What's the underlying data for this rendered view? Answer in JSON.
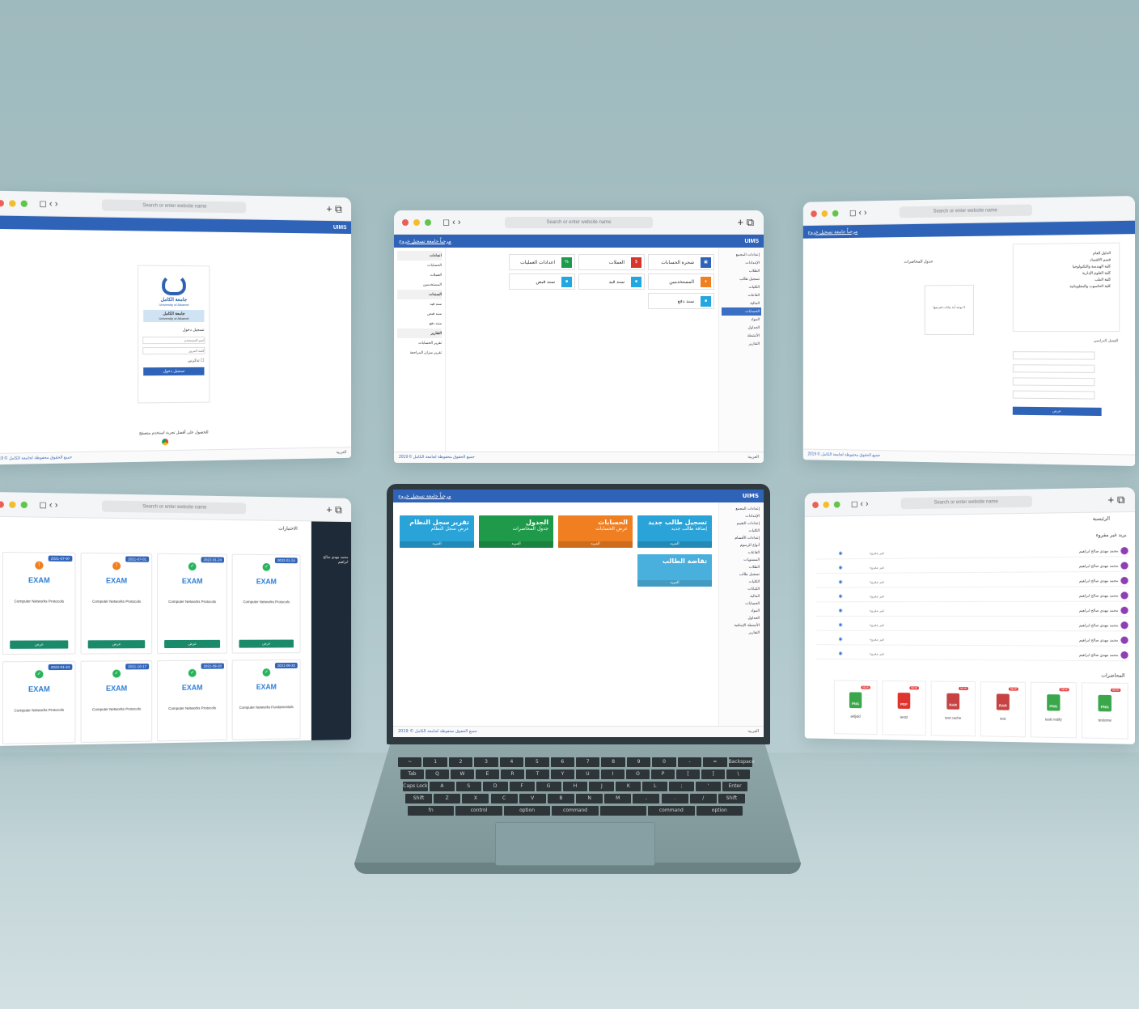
{
  "colors": {
    "accent": "#2f63b8",
    "background": "#a8c1c5",
    "laptop": "#7e9598"
  },
  "browser": {
    "search_placeholder": "Search or enter website name",
    "controls": "◻ ‹ ›",
    "new_tab": "+ ⧉"
  },
  "app": {
    "name": "UIMS",
    "breadcrumb": "مرحباً جامعة تسجيل خروج",
    "footer_link": "جميع الحقوق محفوظة لجامعة الكامل © 2019",
    "lang": "العربية"
  },
  "login": {
    "logo_text": "جامعة الكامل",
    "logo_sub": "University of Alkamel",
    "banner_title": "جامعة الكامل",
    "banner_sub": "University of Alkamel",
    "section": "تسجيل دخول",
    "user_placeholder": "اسم المستخدم",
    "pass_placeholder": "كلمة المرور",
    "remember": "تذكرني",
    "submit": "تسجيل دخول",
    "browser_note": "للحصول على أفضل تجربة استخدم متصفح"
  },
  "accounts": {
    "tiles": [
      {
        "label": "شجرة الحسابات",
        "color": "#2f63b8"
      },
      {
        "label": "العملات",
        "color": "#d9342b"
      },
      {
        "label": "اعدادات العمليات",
        "color": "#1e9a4b"
      },
      {
        "label": "المستخدمين",
        "color": "#f07f21"
      },
      {
        "label": "سند قيد",
        "color": "#22a7e0"
      },
      {
        "label": "سند قبض",
        "color": "#22a7e0"
      },
      {
        "label": "سند دفع",
        "color": "#22a7e0"
      }
    ],
    "sidebar": [
      "اعدادات",
      "الحسابات",
      "العملات",
      "المستخدمين",
      "السندات",
      "سند قيد",
      "سند قبض",
      "سند دفع",
      "التقارير",
      "تقرير الحسابات",
      "تقرير ميزان المراجعة"
    ]
  },
  "schedule": {
    "heading": "جدول المحاضرات",
    "empty_note": "لا توجد أية بيانات لعرضها",
    "tree": [
      "الدليل العام",
      "قسم الاقتصاد",
      "كلية الهندسة والتكنولوجيا",
      "كلية العلوم الإدارية",
      "كلية الطب",
      "كلية الحاسوب والمعلوماتية"
    ],
    "form_title": "الفصل الدراسي",
    "submit": "عرض"
  },
  "exams": {
    "title": "الاختبارات",
    "user": "محمد مهدي صالح ابراهيم",
    "cards": [
      {
        "date": "2022-01-24",
        "name": "Computer Networks Protocols",
        "status_color": "#27b45c"
      },
      {
        "date": "2022-01-24",
        "name": "Computer Networks Protocols",
        "status_color": "#27b45c"
      },
      {
        "date": "2021-07-01",
        "name": "Computer Networks Protocols",
        "status_color": "#f07f21"
      },
      {
        "date": "2021-07-07",
        "name": "Computer Networks Protocols",
        "status_color": "#f07f21"
      },
      {
        "date": "2021-09-20",
        "name": "Computer Networks Fundamentals",
        "status_color": "#27b45c"
      },
      {
        "date": "2021-09-20",
        "name": "Computer Networks Protocols",
        "status_color": "#27b45c"
      },
      {
        "date": "2021-10-17",
        "name": "Computer Networks Protocols",
        "status_color": "#27b45c"
      },
      {
        "date": "2022-01-24",
        "name": "Computer Networks Protocols",
        "status_color": "#27b45c"
      }
    ],
    "exam_label": "EXAM",
    "button": "عرض"
  },
  "dashboard": {
    "tiles": [
      {
        "title": "تسجيل طالب جديد",
        "sub": "إضافة طالب جديد",
        "color": "#2aa3d9"
      },
      {
        "title": "الحسابات",
        "sub": "عرض الحسابات",
        "color": "#f07f21"
      },
      {
        "title": "الجدول",
        "sub": "جدول المحاضرات",
        "color": "#1f9a4a"
      },
      {
        "title": "تقرير سجل النظام",
        "sub": "عرض سجل النظام",
        "color": "#2aa3d9"
      },
      {
        "title": "تقاضة الطالب",
        "sub": "",
        "color": "#2aa3d9"
      }
    ],
    "more": "المزيد"
  },
  "inbox": {
    "title": "الرئيسية",
    "section": "بريد غير مقروء",
    "sender": "محمد مهدي صالح ابراهيم",
    "status": "غير مقروء",
    "lectures": "المحاضرات",
    "files": [
      {
        "type": "PNG",
        "name": "testome",
        "color": "#39a74a"
      },
      {
        "type": "PNG",
        "name": "testt notify",
        "color": "#39a74a"
      },
      {
        "type": "RAR",
        "name": "test",
        "color": "#c74343"
      },
      {
        "type": "RAR",
        "name": "test cache",
        "color": "#c74343"
      },
      {
        "type": "PDF",
        "name": "test2",
        "color": "#e0352f"
      },
      {
        "type": "PNG",
        "name": "ekfjskf",
        "color": "#39a74a"
      }
    ]
  },
  "keyboard": {
    "row1": [
      "~",
      "1",
      "2",
      "3",
      "4",
      "5",
      "6",
      "7",
      "8",
      "9",
      "0",
      "-",
      "=",
      "Backspace"
    ],
    "row2": [
      "Tab",
      "Q",
      "W",
      "E",
      "R",
      "T",
      "Y",
      "U",
      "I",
      "O",
      "P",
      "[",
      "]",
      "\\"
    ],
    "row3": [
      "Caps Lock",
      "A",
      "S",
      "D",
      "F",
      "G",
      "H",
      "J",
      "K",
      "L",
      ";",
      "'",
      "Enter"
    ],
    "row4": [
      "Shift",
      "Z",
      "X",
      "C",
      "V",
      "B",
      "N",
      "M",
      ",",
      ".",
      "/",
      "Shift"
    ],
    "row5": [
      "fn",
      "control",
      "option",
      "command",
      "",
      "command",
      "option"
    ]
  }
}
